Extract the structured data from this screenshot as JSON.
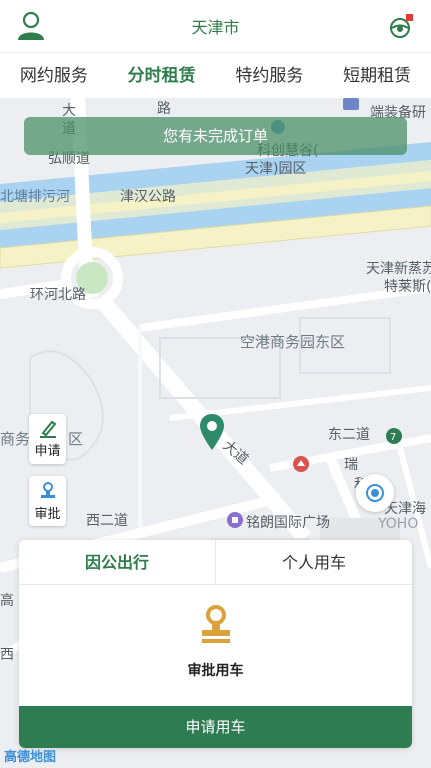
{
  "header": {
    "title": "天津市",
    "user_icon": "user-icon",
    "message_icon": "message-icon",
    "badge_color": "#e53935"
  },
  "tabs": [
    {
      "label": "网约服务",
      "active": false
    },
    {
      "label": "分时租赁",
      "active": true
    },
    {
      "label": "特约服务",
      "active": false
    },
    {
      "label": "短期租赁",
      "active": false
    }
  ],
  "banner": {
    "text": "您有未完成订单"
  },
  "map": {
    "labels": {
      "da": "大",
      "road_lu": "路",
      "dao": "道",
      "hongshundao": "弘顺道",
      "keji": "科创慧谷(",
      "tianjin_park": "天津)园区",
      "duanzhuang": "端装备研",
      "beitang": "北塘排污河",
      "jinhan": "津汉公路",
      "tianjin_xin": "天津新蒸苏",
      "telaisi": "特莱斯(",
      "huanhe": "环河北路",
      "konggang": "空港商务园东区",
      "shangwu": "商务",
      "qu": "区",
      "dadao": "大道",
      "dong2": "东二道",
      "rui": "瑞",
      "he": "和",
      "tianjinhai": "天津海",
      "yoho": "YOHO",
      "xi2": "西二道",
      "minglang": "铭朗国际广场",
      "gao": "高",
      "xi": "西"
    },
    "logo": "高德地图"
  },
  "side_buttons": {
    "apply": "申请",
    "approve": "审批"
  },
  "panel": {
    "tabs": [
      {
        "label": "因公出行",
        "active": true
      },
      {
        "label": "个人用车",
        "active": false
      }
    ],
    "approve_label": "审批用车",
    "apply_button": "申请用车"
  },
  "colors": {
    "primary": "#2e7d52",
    "banner": "#468c64",
    "water": "#a9d3f0",
    "road_main": "#f6f2c8"
  }
}
